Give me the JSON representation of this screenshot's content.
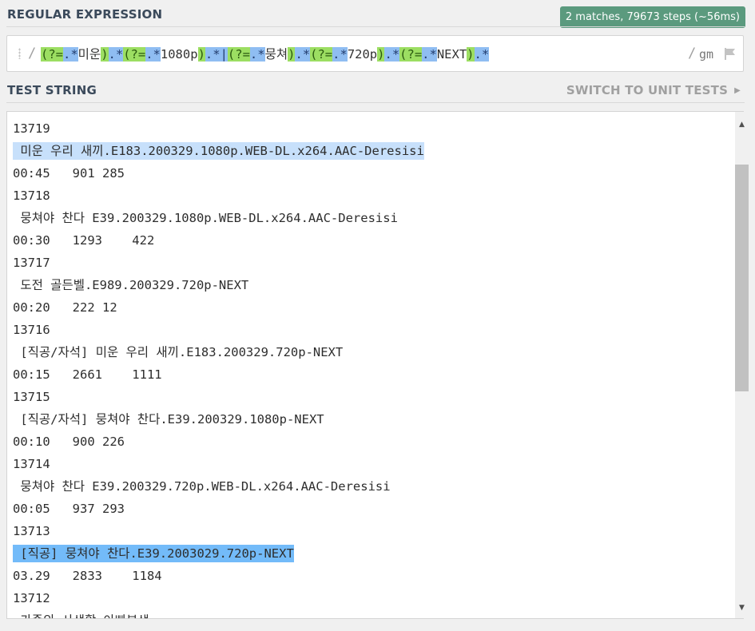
{
  "regex_section": {
    "title": "REGULAR EXPRESSION",
    "match_info": "2 matches, 79673 steps (~56ms)",
    "open_delimiter": "/",
    "close_delimiter": "/",
    "flags": "gm",
    "tokens": [
      {
        "text": "(?=",
        "type": "tok-look"
      },
      {
        "text": ".*",
        "type": "tok-meta"
      },
      {
        "text": "미운",
        "type": "plain"
      },
      {
        "text": ")",
        "type": "tok-look"
      },
      {
        "text": ".*",
        "type": "tok-meta"
      },
      {
        "text": "(?=",
        "type": "tok-look"
      },
      {
        "text": ".*",
        "type": "tok-meta"
      },
      {
        "text": "1080p",
        "type": "plain"
      },
      {
        "text": ")",
        "type": "tok-look"
      },
      {
        "text": ".*",
        "type": "tok-meta"
      },
      {
        "text": "|",
        "type": "tok-alt"
      },
      {
        "text": "(?=",
        "type": "tok-look"
      },
      {
        "text": ".*",
        "type": "tok-meta"
      },
      {
        "text": "뭉쳐",
        "type": "plain"
      },
      {
        "text": ")",
        "type": "tok-look"
      },
      {
        "text": ".*",
        "type": "tok-meta"
      },
      {
        "text": "(?=",
        "type": "tok-look"
      },
      {
        "text": ".*",
        "type": "tok-meta"
      },
      {
        "text": "720p",
        "type": "plain"
      },
      {
        "text": ")",
        "type": "tok-look"
      },
      {
        "text": ".*",
        "type": "tok-meta"
      },
      {
        "text": "(?=",
        "type": "tok-look"
      },
      {
        "text": ".*",
        "type": "tok-meta"
      },
      {
        "text": "NEXT",
        "type": "plain"
      },
      {
        "text": ")",
        "type": "tok-look"
      },
      {
        "text": ".*",
        "type": "tok-meta"
      }
    ],
    "flag_icon": "flag-icon",
    "drag_icon": "drag-handle-icon"
  },
  "test_section": {
    "title": "TEST STRING",
    "switch_label": "SWITCH TO UNIT TESTS",
    "switch_arrow_icon": "chevron-right-icon",
    "lines": [
      {
        "text": "13719",
        "highlight": ""
      },
      {
        "text": " 미운 우리 새끼.E183.200329.1080p.WEB-DL.x264.AAC-Deresisi",
        "highlight": "hl"
      },
      {
        "text": "00:45   901 285",
        "highlight": ""
      },
      {
        "text": "13718",
        "highlight": ""
      },
      {
        "text": " 뭉쳐야 찬다 E39.200329.1080p.WEB-DL.x264.AAC-Deresisi",
        "highlight": ""
      },
      {
        "text": "00:30   1293    422",
        "highlight": ""
      },
      {
        "text": "13717",
        "highlight": ""
      },
      {
        "text": " 도전 골든벨.E989.200329.720p-NEXT",
        "highlight": ""
      },
      {
        "text": "00:20   222 12",
        "highlight": ""
      },
      {
        "text": "13716",
        "highlight": ""
      },
      {
        "text": " [직공/자석] 미운 우리 새끼.E183.200329.720p-NEXT",
        "highlight": ""
      },
      {
        "text": "00:15   2661    1111",
        "highlight": ""
      },
      {
        "text": "13715",
        "highlight": ""
      },
      {
        "text": " [직공/자석] 뭉쳐야 찬다.E39.200329.1080p-NEXT",
        "highlight": ""
      },
      {
        "text": "00:10   900 226",
        "highlight": ""
      },
      {
        "text": "13714",
        "highlight": ""
      },
      {
        "text": " 뭉쳐야 찬다 E39.200329.720p.WEB-DL.x264.AAC-Deresisi",
        "highlight": ""
      },
      {
        "text": "00:05   937 293",
        "highlight": ""
      },
      {
        "text": "13713",
        "highlight": ""
      },
      {
        "text": " [직공] 뭉쳐야 찬다.E39.2003029.720p-NEXT",
        "highlight": "hl2"
      },
      {
        "text": "03.29   2833    1184",
        "highlight": ""
      },
      {
        "text": "13712",
        "highlight": ""
      },
      {
        "text": " 가족의 사생활 아빠본색",
        "highlight": ""
      }
    ]
  },
  "scrollbar": {
    "up_icon": "scroll-up-arrow-icon",
    "down_icon": "scroll-down-arrow-icon"
  }
}
